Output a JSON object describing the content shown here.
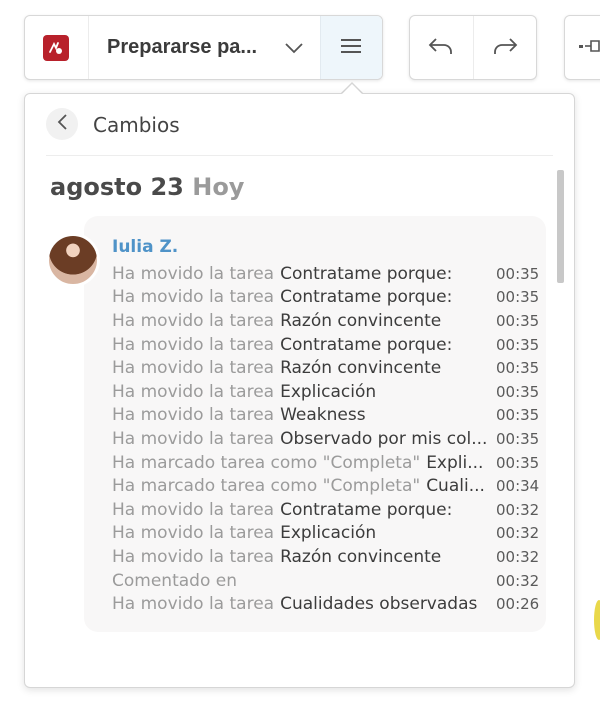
{
  "toolbar": {
    "document_title": "Prepararse pa...",
    "app_icon": "app-logo-icon",
    "menu_icon": "hamburger-menu-icon",
    "undo_icon": "undo-icon",
    "redo_icon": "redo-icon"
  },
  "panel": {
    "title": "Cambios",
    "back_icon": "chevron-left-icon",
    "day": {
      "date": "agosto 23",
      "relative": "Hoy"
    },
    "user": {
      "name": "Iulia Z."
    },
    "entries": [
      {
        "verb": "Ha movido la tarea",
        "target": "Contratame porque:",
        "time": "00:35"
      },
      {
        "verb": "Ha movido la tarea",
        "target": "Contratame porque:",
        "time": "00:35"
      },
      {
        "verb": "Ha movido la tarea",
        "target": "Razón convincente",
        "time": "00:35"
      },
      {
        "verb": "Ha movido la tarea",
        "target": "Contratame porque:",
        "time": "00:35"
      },
      {
        "verb": "Ha movido la tarea",
        "target": "Razón convincente",
        "time": "00:35"
      },
      {
        "verb": "Ha movido la tarea",
        "target": "Explicación",
        "time": "00:35"
      },
      {
        "verb": "Ha movido la tarea",
        "target": "Weakness",
        "time": "00:35"
      },
      {
        "verb": "Ha movido la tarea",
        "target": "Observado por mis col...",
        "time": "00:35"
      },
      {
        "verb": "Ha marcado tarea como \"Completa\"",
        "target": "Expli...",
        "time": "00:35"
      },
      {
        "verb": "Ha marcado tarea como \"Completa\"",
        "target": "Cuali...",
        "time": "00:34"
      },
      {
        "verb": "Ha movido la tarea",
        "target": "Contratame porque:",
        "time": "00:32"
      },
      {
        "verb": "Ha movido la tarea",
        "target": "Explicación",
        "time": "00:32"
      },
      {
        "verb": "Ha movido la tarea",
        "target": "Razón convincente",
        "time": "00:32"
      },
      {
        "verb": "Comentado en",
        "target": "",
        "time": "00:32"
      },
      {
        "verb": "Ha movido la tarea",
        "target": "Cualidades observadas",
        "time": "00:26"
      }
    ]
  },
  "colors": {
    "accent": "#4f93c8",
    "brand": "#b8212b",
    "menu_active_bg": "#eef6fb"
  }
}
